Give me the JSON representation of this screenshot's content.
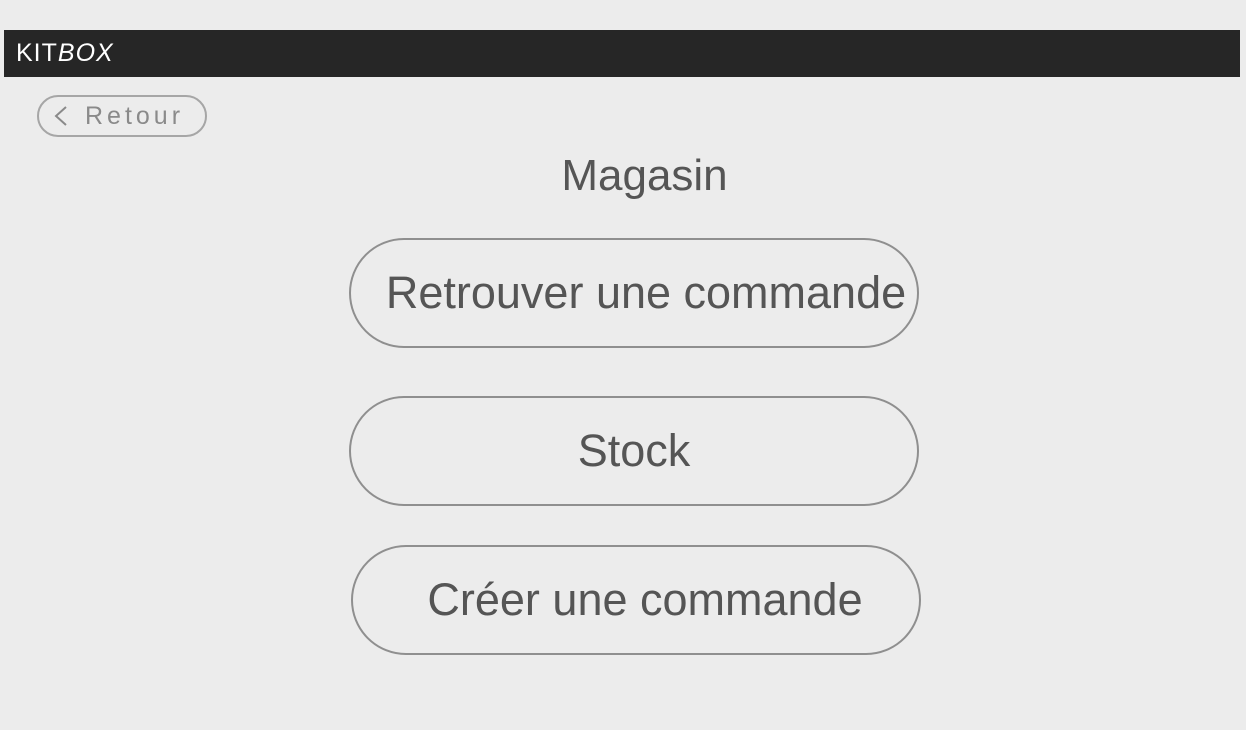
{
  "header": {
    "logo_kit": "KIT",
    "logo_box": "BOX"
  },
  "back_button": {
    "icon": "chevron-left-icon",
    "label": "Retour"
  },
  "page": {
    "title": "Magasin"
  },
  "menu": {
    "items": [
      {
        "label": "Retrouver une commande"
      },
      {
        "label": "Stock"
      },
      {
        "label": "Créer une commande"
      }
    ]
  },
  "colors": {
    "background": "#ececec",
    "header_bar": "#262626",
    "text": "#555555",
    "button_border": "#8f8f8f"
  }
}
